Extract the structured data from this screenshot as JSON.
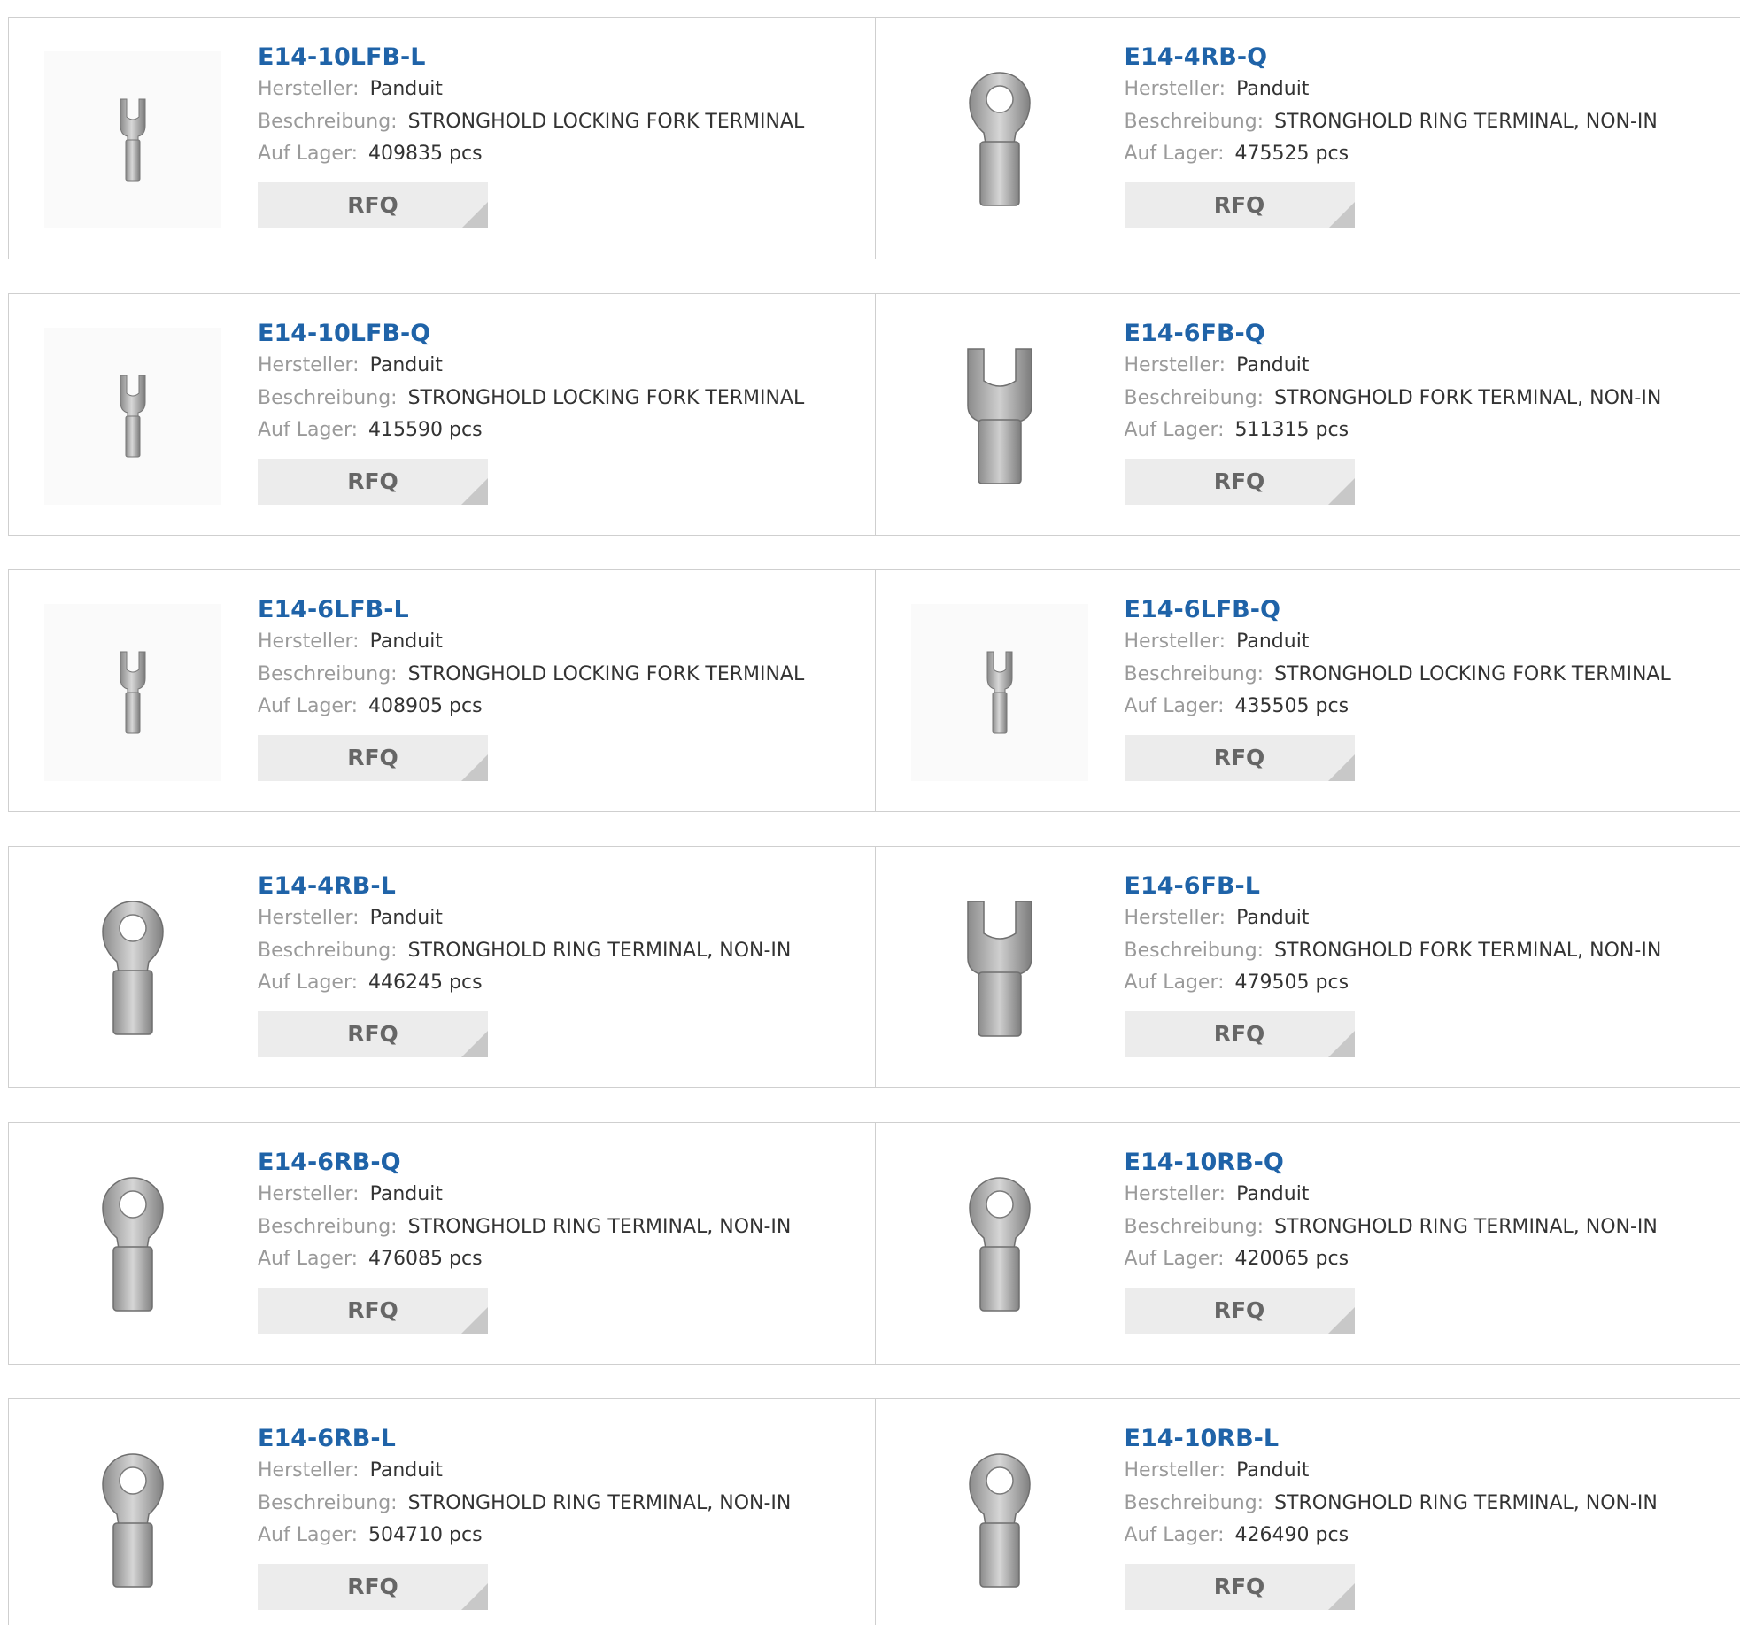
{
  "labels": {
    "manufacturer": "Hersteller:",
    "description": "Beschreibung:",
    "stock": "Auf Lager:",
    "rfq": "RFQ"
  },
  "colors": {
    "title": "#1f63a8",
    "label": "#9a9a9a",
    "value": "#333333",
    "button_bg": "#ececec",
    "border": "#cfcfcf"
  },
  "products": [
    {
      "part": "E14-10LFB-L",
      "manufacturer": "Panduit",
      "description": "STRONGHOLD LOCKING FORK TERMINAL",
      "stock": "409835 pcs",
      "icon": "locking-fork-terminal-icon"
    },
    {
      "part": "E14-4RB-Q",
      "manufacturer": "Panduit",
      "description": "STRONGHOLD RING TERMINAL, NON-IN",
      "stock": "475525 pcs",
      "icon": "ring-terminal-icon"
    },
    {
      "part": "E14-10LFB-Q",
      "manufacturer": "Panduit",
      "description": "STRONGHOLD LOCKING FORK TERMINAL",
      "stock": "415590 pcs",
      "icon": "locking-fork-terminal-icon"
    },
    {
      "part": "E14-6FB-Q",
      "manufacturer": "Panduit",
      "description": "STRONGHOLD FORK TERMINAL, NON-IN",
      "stock": "511315 pcs",
      "icon": "fork-terminal-icon"
    },
    {
      "part": "E14-6LFB-L",
      "manufacturer": "Panduit",
      "description": "STRONGHOLD LOCKING FORK TERMINAL",
      "stock": "408905 pcs",
      "icon": "locking-fork-terminal-icon"
    },
    {
      "part": "E14-6LFB-Q",
      "manufacturer": "Panduit",
      "description": "STRONGHOLD LOCKING FORK TERMINAL",
      "stock": "435505 pcs",
      "icon": "locking-fork-terminal-icon"
    },
    {
      "part": "E14-4RB-L",
      "manufacturer": "Panduit",
      "description": "STRONGHOLD RING TERMINAL, NON-IN",
      "stock": "446245 pcs",
      "icon": "ring-terminal-icon"
    },
    {
      "part": "E14-6FB-L",
      "manufacturer": "Panduit",
      "description": "STRONGHOLD FORK TERMINAL, NON-IN",
      "stock": "479505 pcs",
      "icon": "fork-terminal-icon"
    },
    {
      "part": "E14-6RB-Q",
      "manufacturer": "Panduit",
      "description": "STRONGHOLD RING TERMINAL, NON-IN",
      "stock": "476085 pcs",
      "icon": "ring-terminal-icon"
    },
    {
      "part": "E14-10RB-Q",
      "manufacturer": "Panduit",
      "description": "STRONGHOLD RING TERMINAL, NON-IN",
      "stock": "420065 pcs",
      "icon": "ring-terminal-icon"
    },
    {
      "part": "E14-6RB-L",
      "manufacturer": "Panduit",
      "description": "STRONGHOLD RING TERMINAL, NON-IN",
      "stock": "504710 pcs",
      "icon": "ring-terminal-icon"
    },
    {
      "part": "E14-10RB-L",
      "manufacturer": "Panduit",
      "description": "STRONGHOLD RING TERMINAL, NON-IN",
      "stock": "426490 pcs",
      "icon": "ring-terminal-icon"
    }
  ]
}
